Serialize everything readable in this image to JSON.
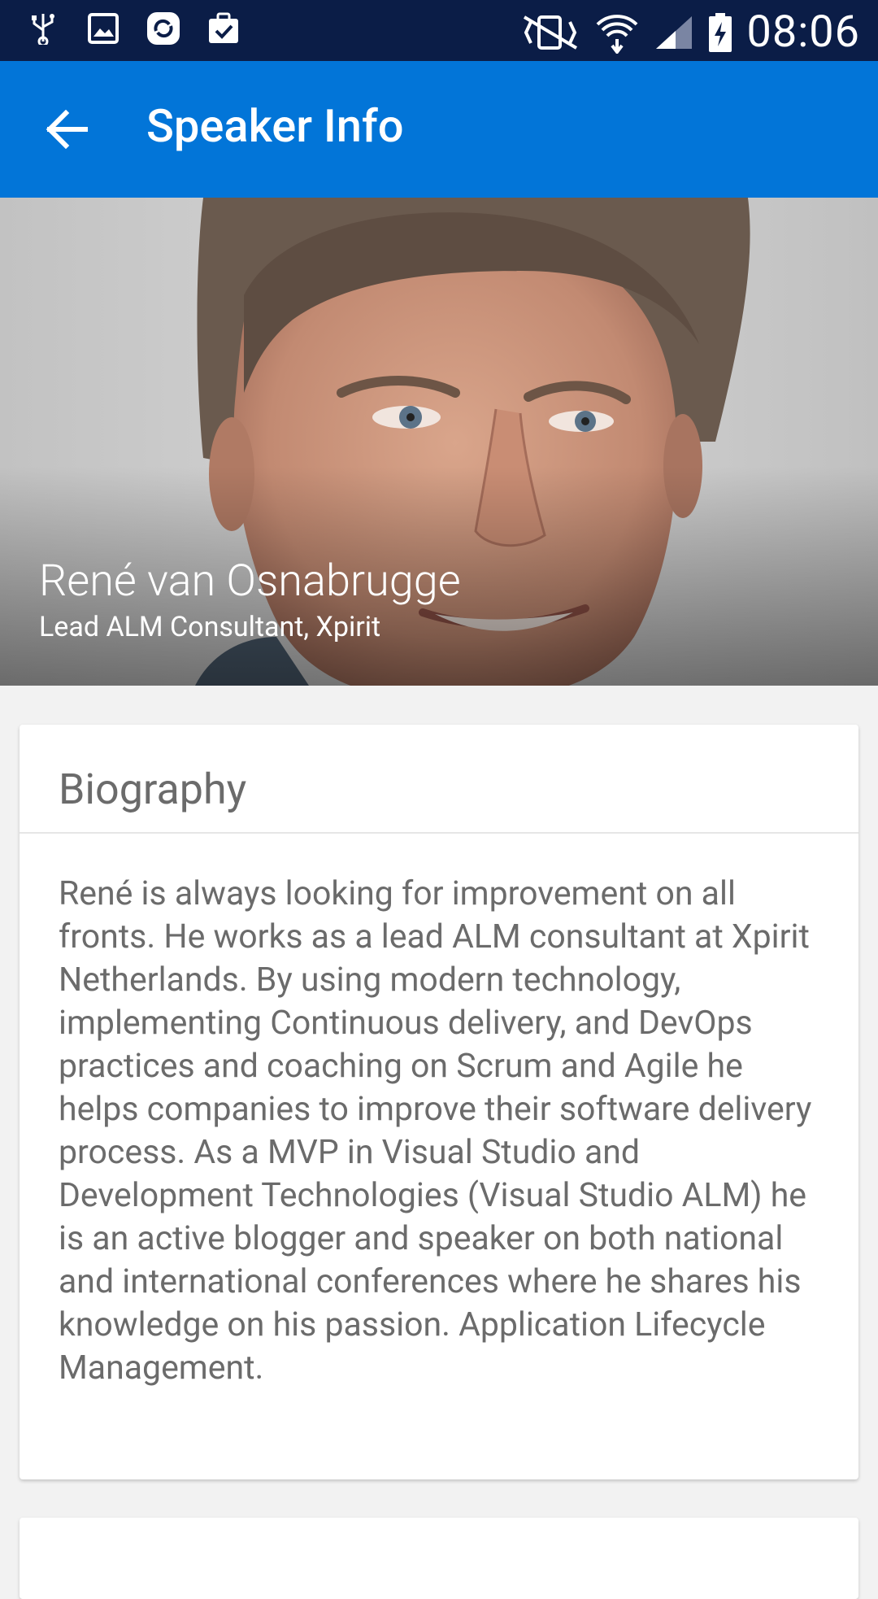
{
  "status_bar": {
    "time": "08:06",
    "left_icons": [
      "usb-icon",
      "image-icon",
      "sync-app-icon",
      "clipboard-check-icon"
    ],
    "right_icons": [
      "vibrate-icon",
      "wifi-icon",
      "signal-icon",
      "battery-charging-icon"
    ]
  },
  "app_bar": {
    "title": "Speaker Info",
    "back_icon": "arrow-back-icon",
    "color": "#0275d8"
  },
  "speaker": {
    "name": "René van Osnabrugge",
    "title": "Lead ALM Consultant, Xpirit"
  },
  "biography": {
    "heading": "Biography",
    "text": "René is always looking for improvement on all fronts. He works as a lead ALM consultant at Xpirit Netherlands. By using modern technology, implementing Continuous delivery, and DevOps practices and coaching on Scrum and Agile he helps companies to improve their software delivery process. As a MVP in Visual Studio and Development Technologies (Visual Studio ALM) he is an active blogger and speaker on both national and international conferences where he shares his knowledge on his passion. Application Lifecycle Management."
  },
  "colors": {
    "status_bar": "#0b1d47",
    "app_bar": "#0275d8",
    "background": "#f2f2f2",
    "text_muted": "#6b6b6b"
  }
}
